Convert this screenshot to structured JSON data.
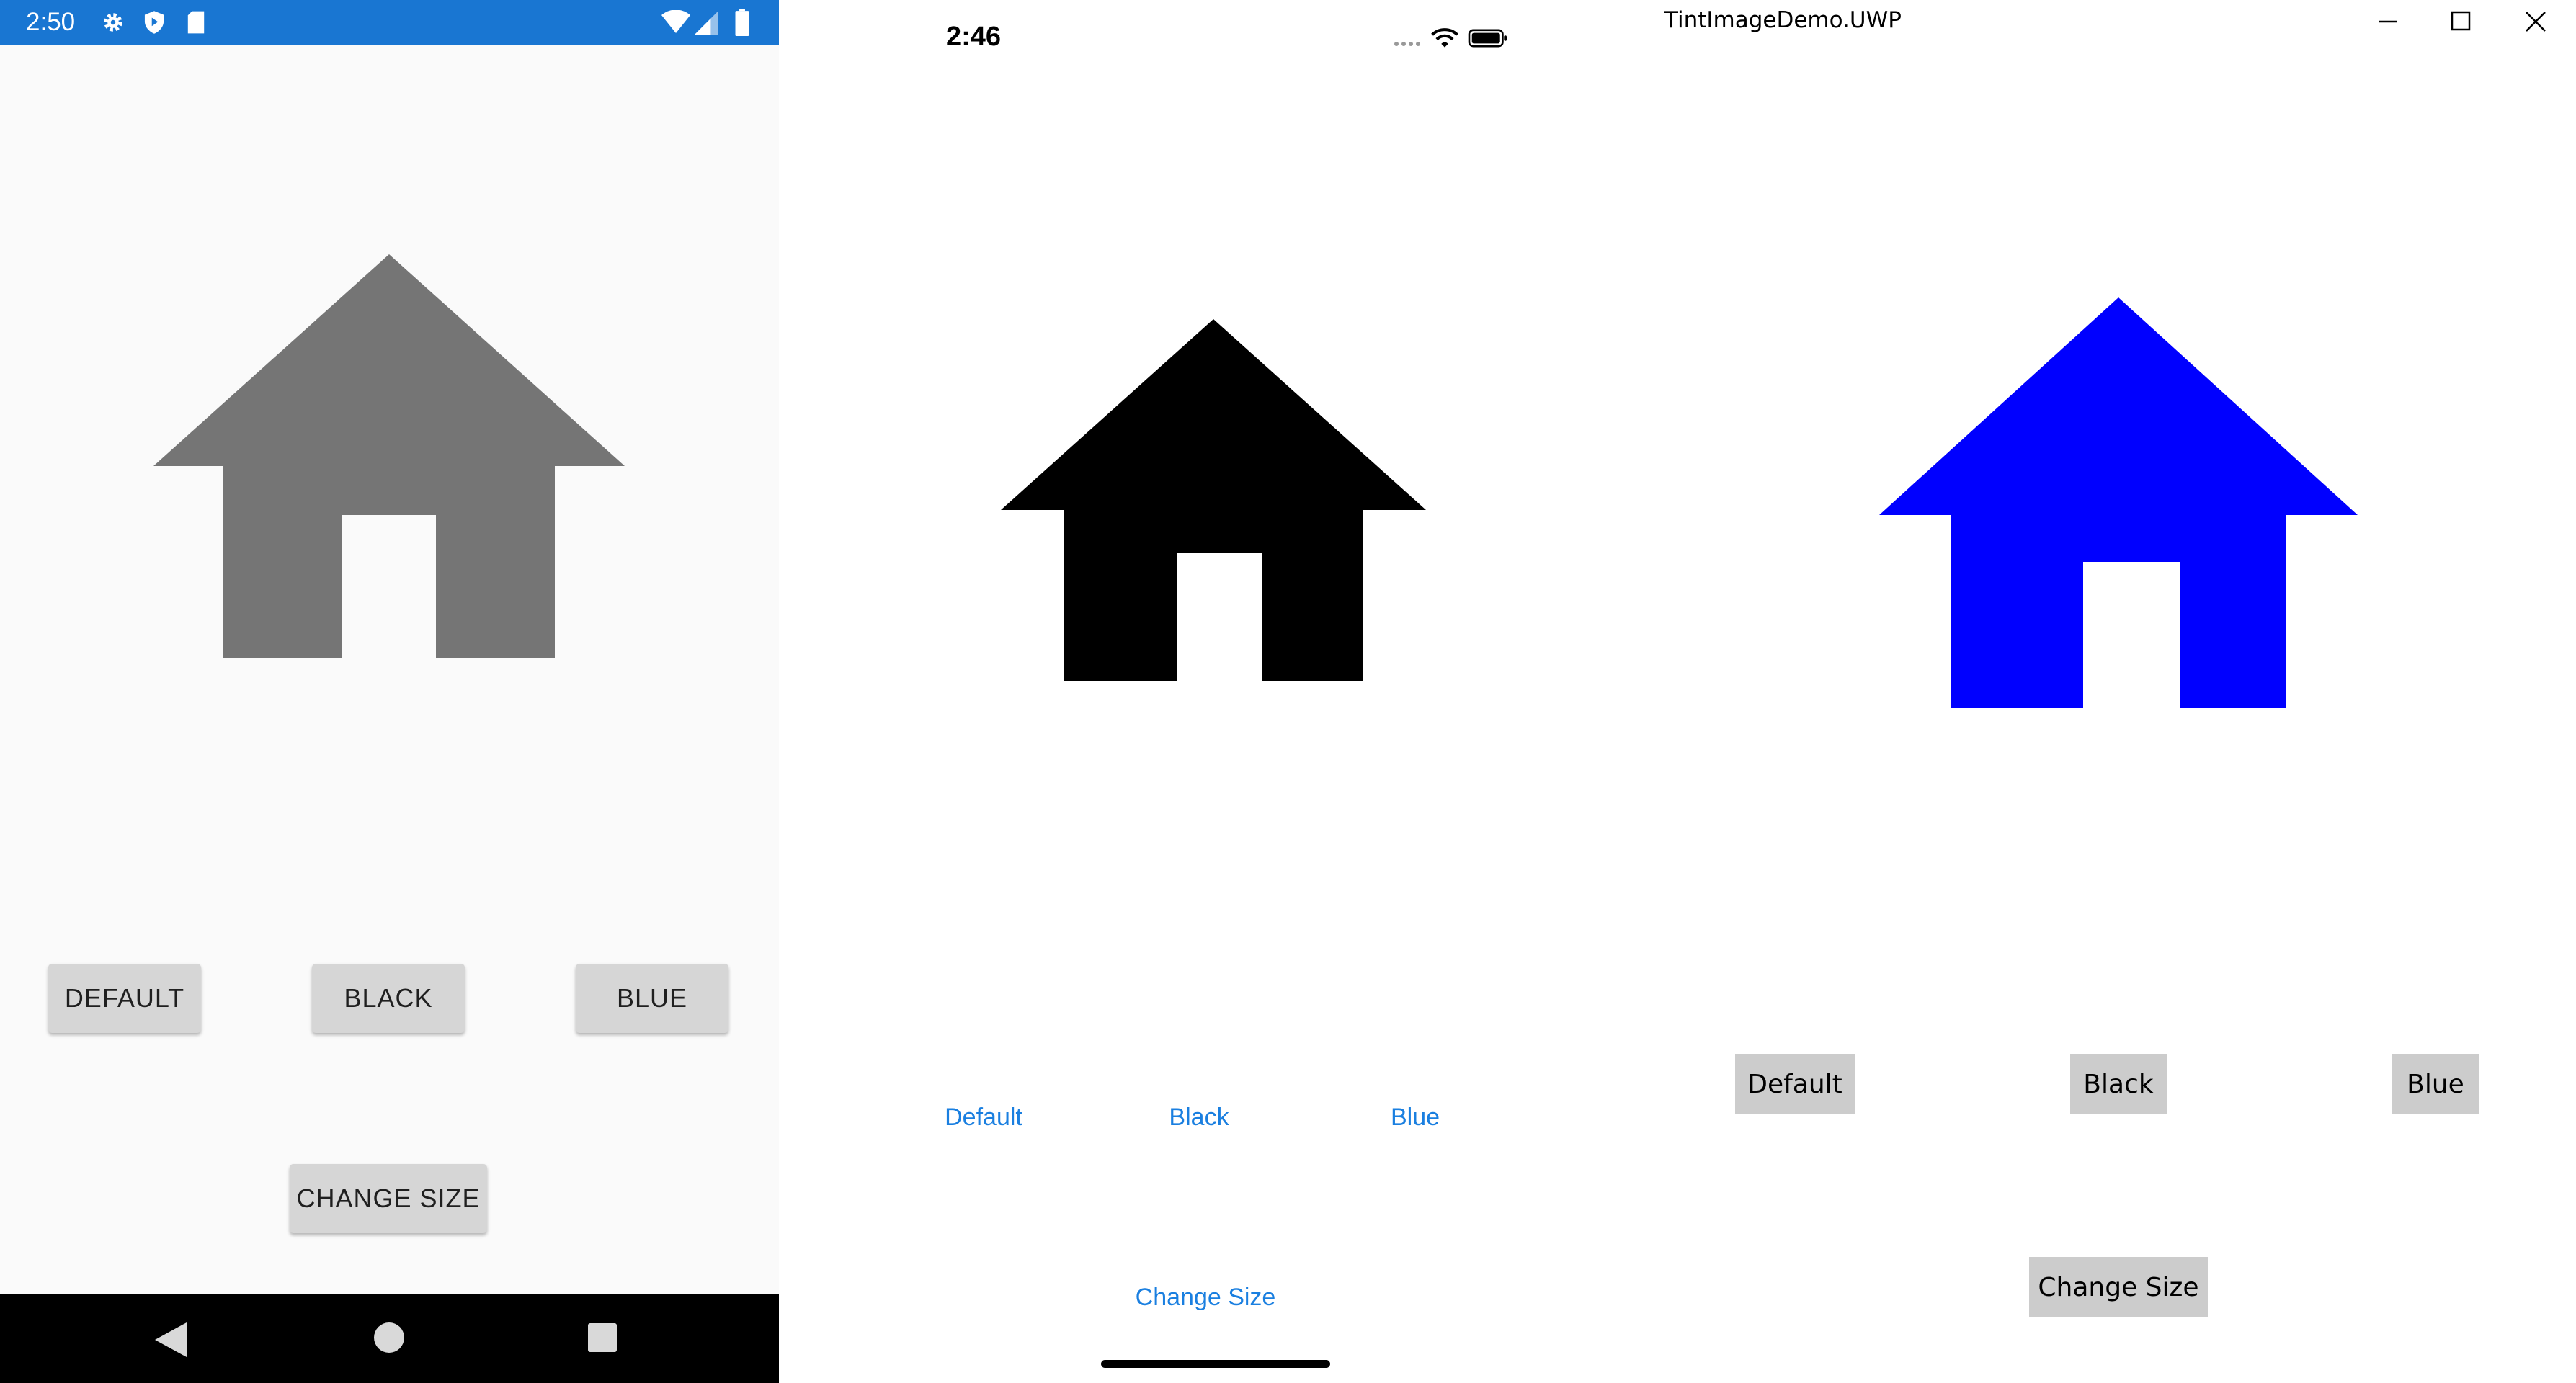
{
  "android": {
    "status_time": "2:50",
    "status_icons": [
      "settings-icon",
      "shield-icon",
      "sd-card-icon",
      "wifi-icon",
      "signal-icon",
      "battery-icon"
    ],
    "image_icon": "house-icon",
    "image_color": "#757575",
    "buttons": {
      "default": "DEFAULT",
      "black": "BLACK",
      "blue": "BLUE",
      "change_size": "CHANGE SIZE"
    },
    "nav_icons": [
      "back-icon",
      "home-icon",
      "recents-icon"
    ]
  },
  "ios": {
    "status_time": "2:46",
    "status_icons": [
      "signal-dots-icon",
      "wifi-icon",
      "battery-icon"
    ],
    "image_icon": "house-icon",
    "image_color": "#000000",
    "buttons": {
      "default": "Default",
      "black": "Black",
      "blue": "Blue",
      "change_size": "Change Size"
    },
    "link_color": "#1a7fe0"
  },
  "uwp": {
    "window_title": "TintImageDemo.UWP",
    "window_controls": [
      "minimize-icon",
      "maximize-icon",
      "close-icon"
    ],
    "image_icon": "house-icon",
    "image_color": "#0000ff",
    "buttons": {
      "default": "Default",
      "black": "Black",
      "blue": "Blue",
      "change_size": "Change Size"
    }
  }
}
